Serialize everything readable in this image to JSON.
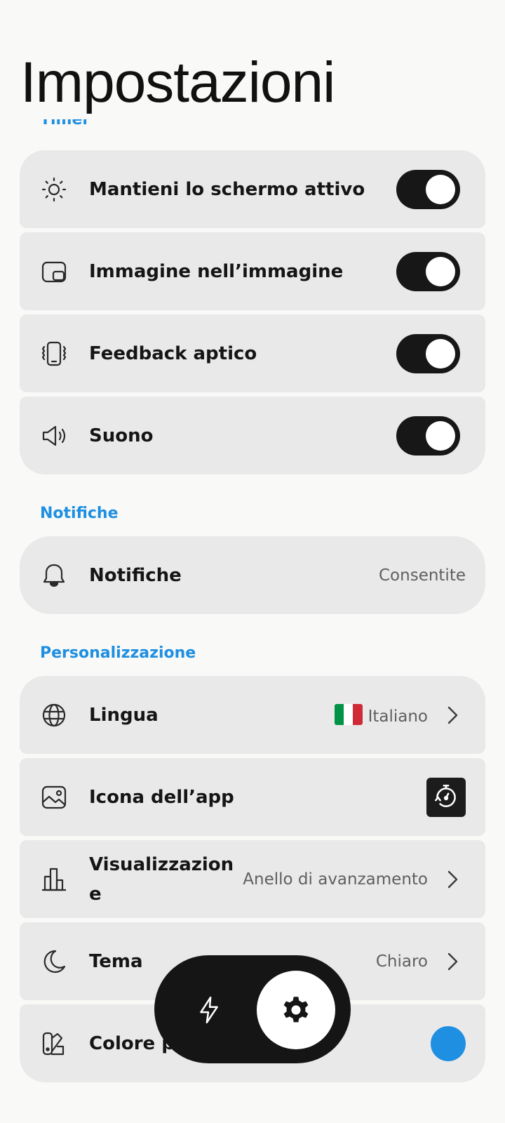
{
  "header": {
    "title": "Impostazioni"
  },
  "sections": {
    "timer": {
      "label": "Timer",
      "items": [
        {
          "label": "Mantieni lo schermo attivo",
          "icon": "sun-icon",
          "toggle_on": true
        },
        {
          "label": "Immagine nell’immagine",
          "icon": "picture-in-picture-icon",
          "toggle_on": true
        },
        {
          "label": "Feedback aptico",
          "icon": "phone-vibrate-icon",
          "toggle_on": true
        },
        {
          "label": "Suono",
          "icon": "speaker-icon",
          "toggle_on": true
        }
      ]
    },
    "notifications": {
      "label": "Notifiche",
      "items": [
        {
          "label": "Notifiche",
          "icon": "bell-icon",
          "value": "Consentite"
        }
      ]
    },
    "personalization": {
      "label": "Personalizzazione",
      "items": [
        {
          "label": "Lingua",
          "icon": "globe-icon",
          "value": "Italiano",
          "flag": "italy-flag-icon"
        },
        {
          "label": "Icona dell’app",
          "icon": "image-icon",
          "preview": "stopwatch-app-icon"
        },
        {
          "label": "Visualizzazion",
          "label_wrap": "e",
          "icon": "bar-chart-icon",
          "value": "Anello di avanzamento"
        },
        {
          "label": "Tema",
          "icon": "moon-icon",
          "value": "Chiaro"
        },
        {
          "label": "Colore principale",
          "icon": "palette-icon",
          "color": "#1e8fe1"
        }
      ]
    }
  },
  "bottom_nav": {
    "items": [
      {
        "icon": "lightning-icon",
        "active": false
      },
      {
        "icon": "gear-icon",
        "active": true
      }
    ]
  },
  "colors": {
    "accent": "#1e8fe1",
    "card": "#eae9ea",
    "toggle_on": "#171717",
    "flag_green": "#009246",
    "flag_white": "#ffffff",
    "flag_red": "#ce2b37"
  }
}
